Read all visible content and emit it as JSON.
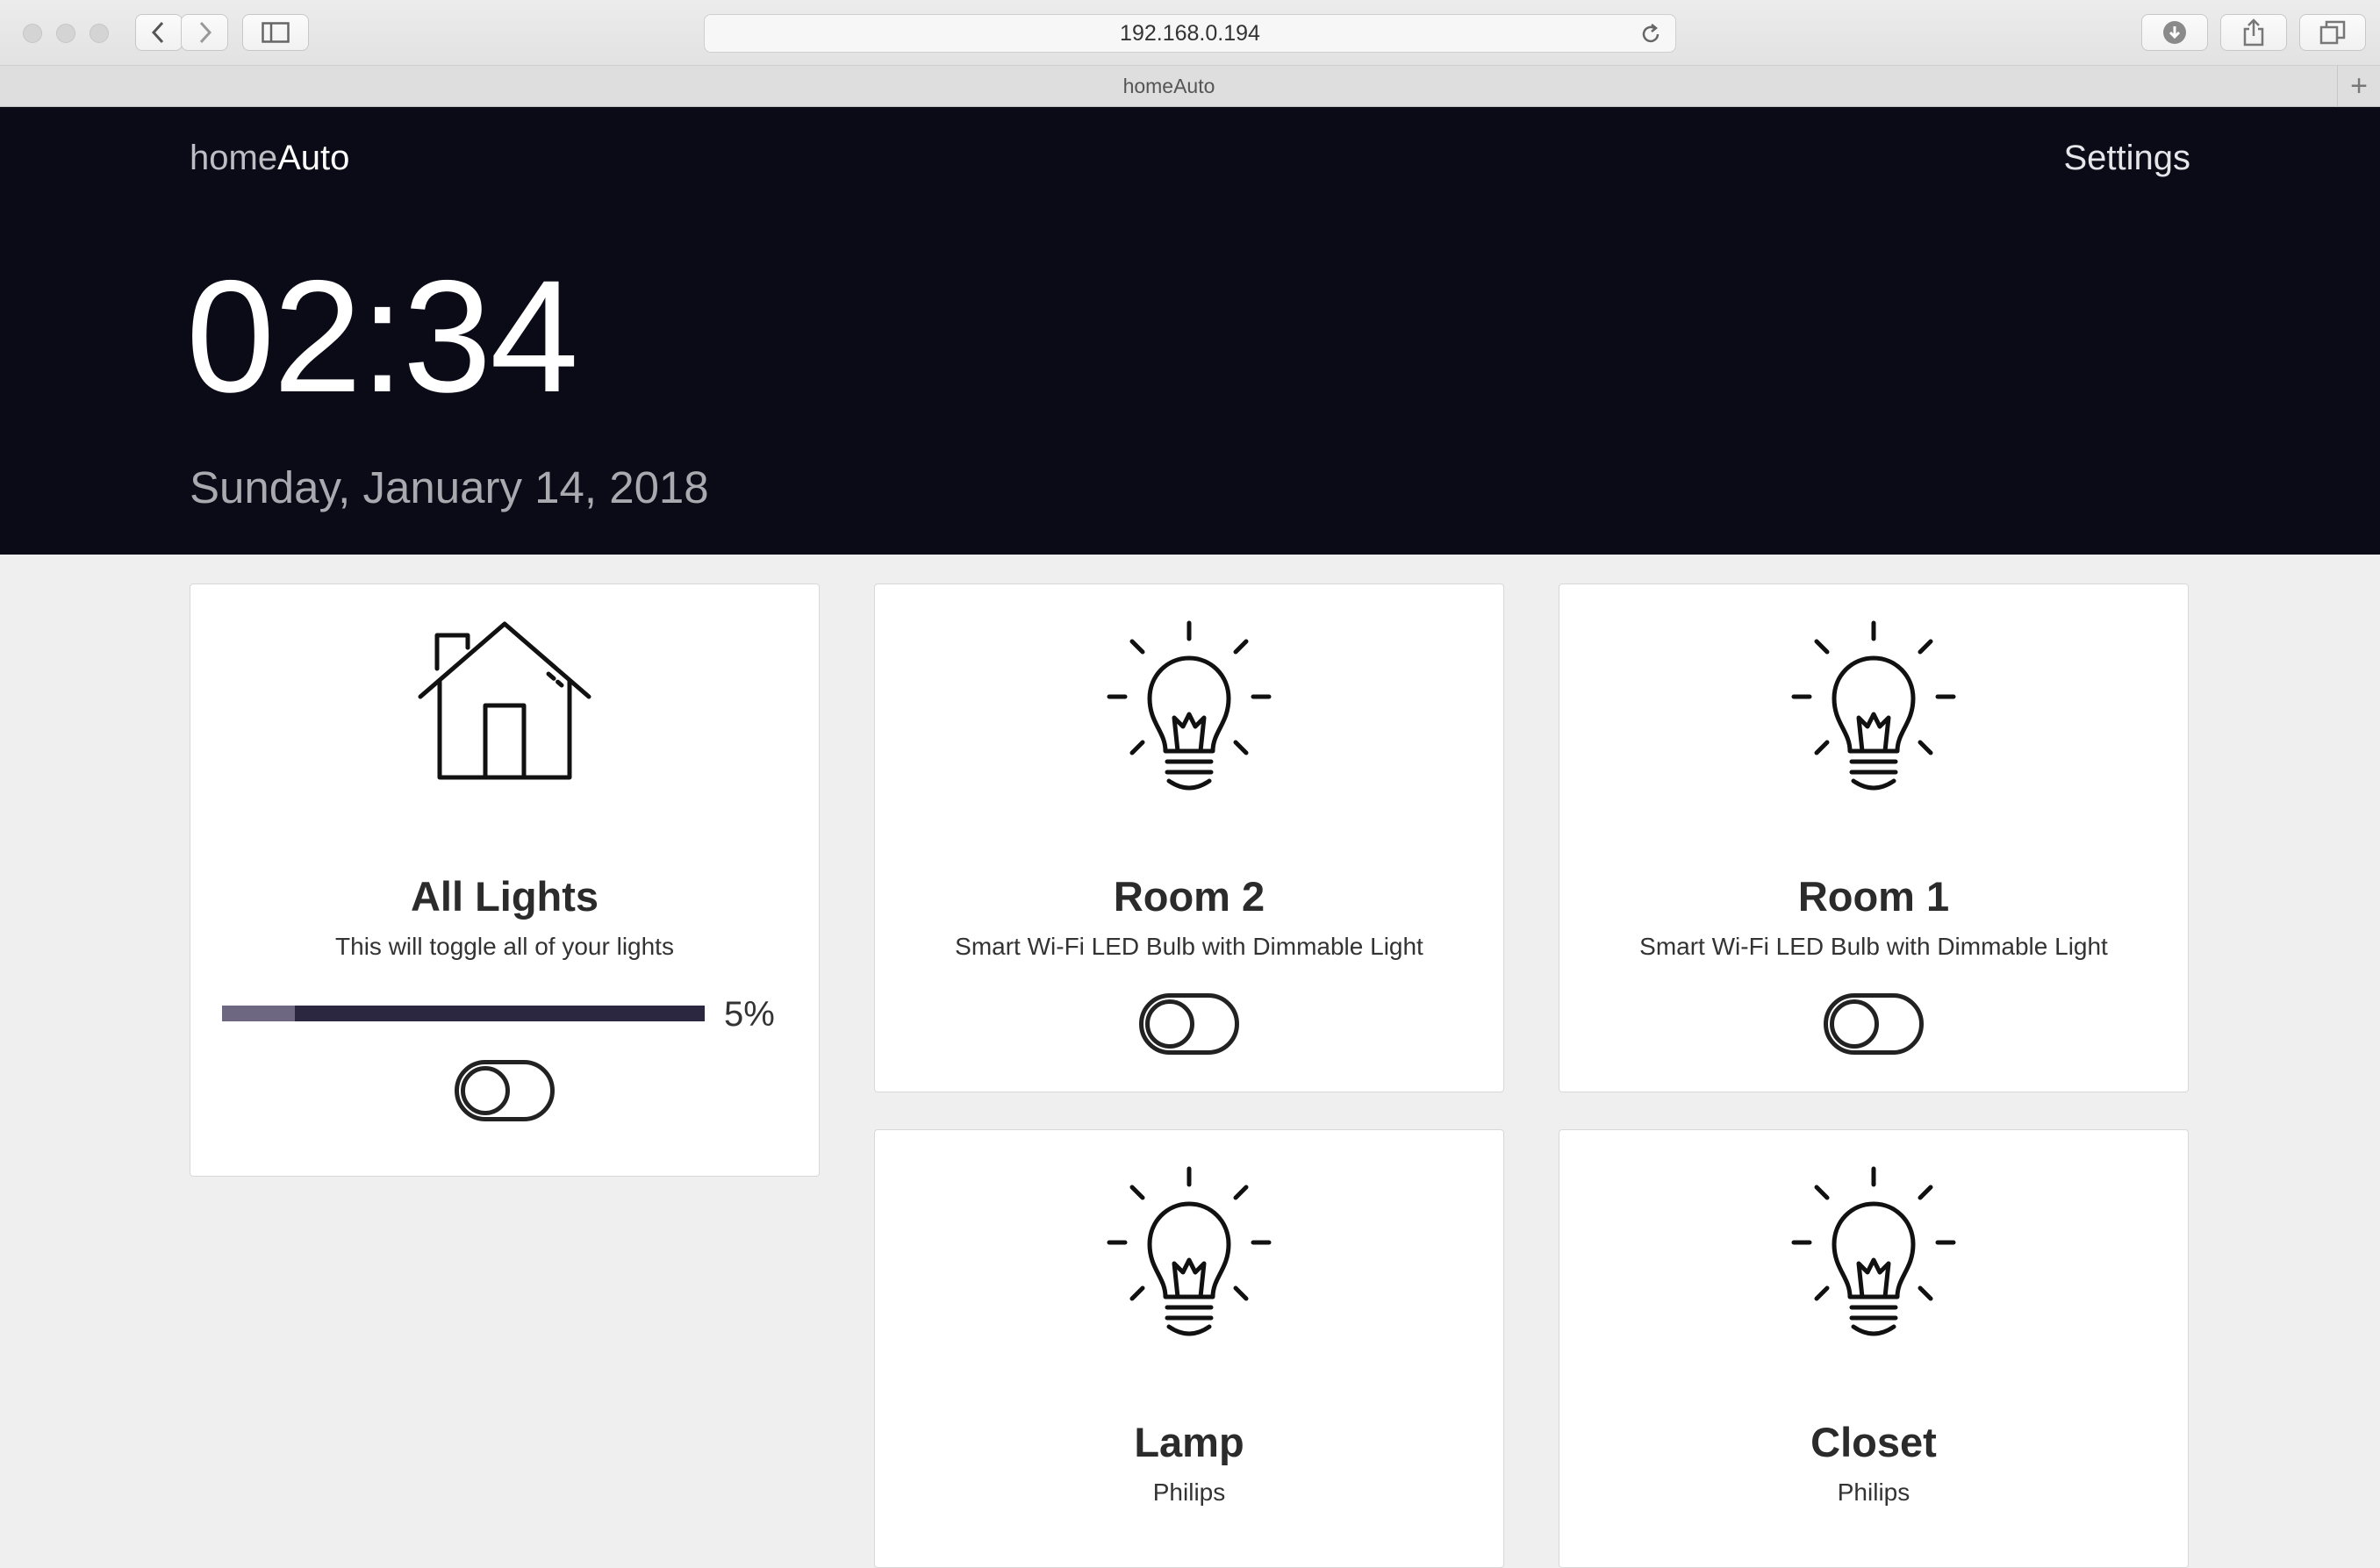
{
  "browser": {
    "url": "192.168.0.194",
    "tab_title": "homeAuto"
  },
  "header": {
    "brand_light": "home",
    "brand_bold": "Auto",
    "settings_label": "Settings"
  },
  "clock": {
    "time": "02:34",
    "date": "Sunday, January 14, 2018"
  },
  "all_lights": {
    "icon": "house-icon",
    "title": "All Lights",
    "subtitle": "This will toggle all of your lights",
    "brightness_label": "5%",
    "brightness": 0.05,
    "on": false
  },
  "devices": [
    {
      "icon": "light-bulb-icon",
      "name": "Room 2",
      "description": "Smart Wi-Fi LED Bulb with Dimmable Light",
      "on": false
    },
    {
      "icon": "light-bulb-icon",
      "name": "Room 1",
      "description": "Smart Wi-Fi LED Bulb with Dimmable Light",
      "on": false
    },
    {
      "icon": "light-bulb-icon",
      "name": "Lamp",
      "description": "Philips",
      "on": false
    },
    {
      "icon": "light-bulb-icon",
      "name": "Closet",
      "description": "Philips",
      "on": false
    }
  ]
}
